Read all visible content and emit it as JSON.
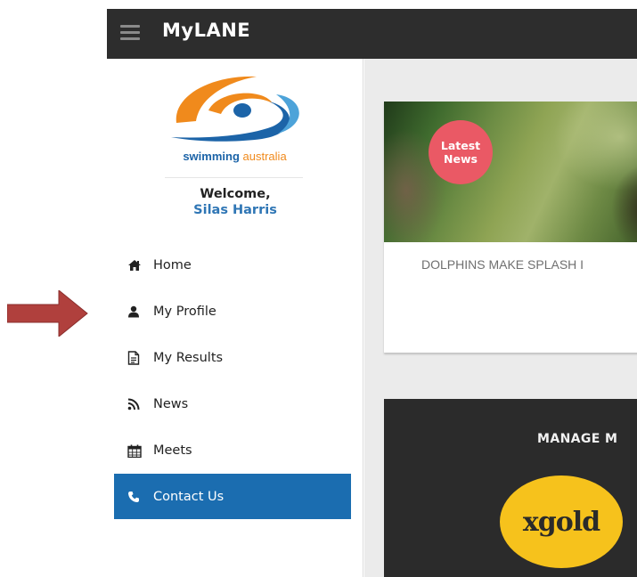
{
  "header": {
    "title": "MyLANE",
    "menu_icon": "hamburger-icon"
  },
  "sidebar": {
    "logo": {
      "brand_word1": "swimming",
      "brand_word2": "australia",
      "colors": {
        "orange": "#f08a1c",
        "blue": "#1c64a8"
      }
    },
    "welcome_label": "Welcome,",
    "user_name": "Silas Harris",
    "nav_items": [
      {
        "label": "Home",
        "icon": "home-icon",
        "active": false
      },
      {
        "label": "My Profile",
        "icon": "user-icon",
        "active": false
      },
      {
        "label": "My Results",
        "icon": "document-icon",
        "active": false
      },
      {
        "label": "News",
        "icon": "rss-icon",
        "active": false
      },
      {
        "label": "Meets",
        "icon": "calendar-icon",
        "active": false
      },
      {
        "label": "Contact Us",
        "icon": "phone-icon",
        "active": true
      }
    ],
    "active_color": "#1b6db0"
  },
  "main": {
    "news_card": {
      "badge_line1": "Latest",
      "badge_line2": "News",
      "badge_color": "#ea5965",
      "headline": "DOLPHINS MAKE SPLASH I"
    },
    "manage_card": {
      "title": "MANAGE M",
      "logo_text": "xgold",
      "logo_color": "#f6c21c"
    }
  },
  "annotation": {
    "arrow_color": "#b0403d",
    "points_to": "My Profile"
  }
}
